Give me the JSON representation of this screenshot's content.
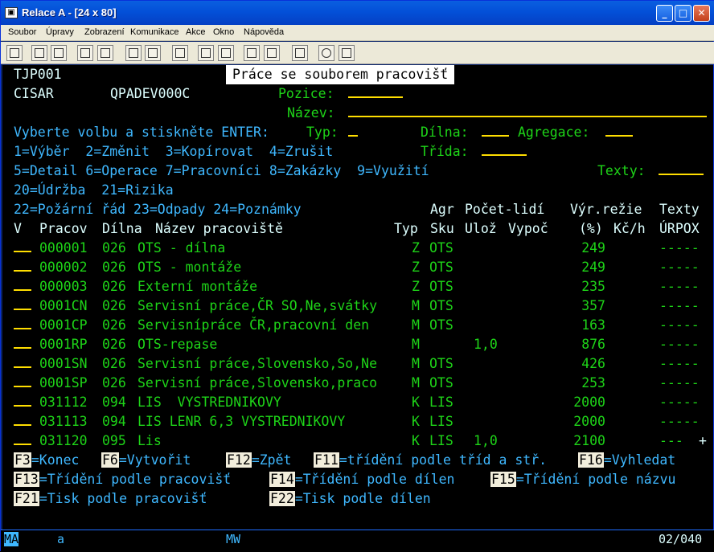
{
  "window": {
    "title": "Relace A - [24 x 80]",
    "icon": "terminal-icon",
    "min": "_",
    "max": "□",
    "close": "✕"
  },
  "menu": [
    "Soubor",
    "Úpravy",
    "Zobrazení",
    "Komunikace",
    "Akce",
    "Okno",
    "Nápověda"
  ],
  "toolbar": [
    "print-screen-icon",
    "copy-icon",
    "paste-icon",
    "send-icon",
    "receive-icon",
    "display-icon",
    "keyboard-icon",
    "macro-icon",
    "record-icon",
    "play-icon",
    "stop-icon",
    "clipboard-icon",
    "globe-icon",
    "pencil-icon"
  ],
  "screen": {
    "sys_id": "TJP001",
    "user": "CISAR",
    "device": "QPADEV000C",
    "title": "Práce se souborem pracovišť",
    "pozice_label": "Pozice:",
    "nazev_label": "Název:",
    "instruction": "Vyberte volbu a stiskněte ENTER:",
    "typ_label": "Typ:",
    "dilna_label": "Dílna:",
    "agregace_label": "Agregace:",
    "trida_label": "Třída:",
    "texty_label": "Texty:",
    "opt1": "1=Výběr  2=Změnit  3=Kopírovat  4=Zrušit",
    "opt2": "5=Detail 6=Operace 7=Pracovníci 8=Zakázky  9=Využití",
    "opt3": "20=Údržba  21=Rizika",
    "opt4": "22=Požární řád 23=Odpady 24=Poznámky",
    "h1": {
      "agr": "Agr",
      "pocet": "Počet-lidí",
      "vyr": "Výr.režie",
      "texty": "Texty"
    },
    "h2": {
      "v": "V",
      "prac": "Pracov",
      "dilna": "Dílna",
      "nazev": "Název pracoviště",
      "typ": "Typ",
      "sku": "Sku",
      "uloz": "Ulož",
      "vypoc": "Vypoč",
      "pct": "(%)",
      "kch": "Kč/h",
      "urpox": "ÚRPOX"
    },
    "rows": [
      {
        "prac": "000001",
        "dilna": "026",
        "nazev": "OTS - dílna",
        "typ": "Z",
        "sku": "OTS",
        "uloz": "",
        "vyr": "249",
        "texty": "-----"
      },
      {
        "prac": "000002",
        "dilna": "026",
        "nazev": "OTS - montáže",
        "typ": "Z",
        "sku": "OTS",
        "uloz": "",
        "vyr": "249",
        "texty": "-----"
      },
      {
        "prac": "000003",
        "dilna": "026",
        "nazev": "Externí montáže",
        "typ": "Z",
        "sku": "OTS",
        "uloz": "",
        "vyr": "235",
        "texty": "-----"
      },
      {
        "prac": "0001CN",
        "dilna": "026",
        "nazev": "Servisní práce,ČR SO,Ne,svátky",
        "typ": "M",
        "sku": "OTS",
        "uloz": "",
        "vyr": "357",
        "texty": "-----"
      },
      {
        "prac": "0001CP",
        "dilna": "026",
        "nazev": "Servisnípráce ČR,pracovní den",
        "typ": "M",
        "sku": "OTS",
        "uloz": "",
        "vyr": "163",
        "texty": "-----"
      },
      {
        "prac": "0001RP",
        "dilna": "026",
        "nazev": "OTS-repase",
        "typ": "M",
        "sku": "",
        "uloz": "1,0",
        "vyr": "876",
        "texty": "-----"
      },
      {
        "prac": "0001SN",
        "dilna": "026",
        "nazev": "Servisní práce,Slovensko,So,Ne",
        "typ": "M",
        "sku": "OTS",
        "uloz": "",
        "vyr": "426",
        "texty": "-----"
      },
      {
        "prac": "0001SP",
        "dilna": "026",
        "nazev": "Servisní práce,Slovensko,praco",
        "typ": "M",
        "sku": "OTS",
        "uloz": "",
        "vyr": "253",
        "texty": "-----"
      },
      {
        "prac": "031112",
        "dilna": "094",
        "nazev": "LIS  VYSTREDNIKOVY",
        "typ": "K",
        "sku": "LIS",
        "uloz": "",
        "vyr": "2000",
        "texty": "-----"
      },
      {
        "prac": "031113",
        "dilna": "094",
        "nazev": "LIS LENR 6,3 VYSTREDNIKOVY",
        "typ": "K",
        "sku": "LIS",
        "uloz": "",
        "vyr": "2000",
        "texty": "-----"
      },
      {
        "prac": "031120",
        "dilna": "095",
        "nazev": "Lis",
        "typ": "K",
        "sku": "LIS",
        "uloz": "1,0",
        "vyr": "2100",
        "texty": "---"
      }
    ],
    "more": "+",
    "fkeys": [
      [
        {
          "k": "F3",
          "t": "=Konec"
        },
        {
          "k": "F6",
          "t": "=Vytvořit"
        },
        {
          "k": "F12",
          "t": "=Zpět"
        },
        {
          "k": "F11",
          "t": "=třídění podle tříd a stř."
        },
        {
          "k": "F16",
          "t": "=Vyhledat"
        }
      ],
      [
        {
          "k": "F13",
          "t": "=Třídění podle pracovišť"
        },
        {
          "k": "F14",
          "t": "=Třídění podle dílen"
        },
        {
          "k": "F15",
          "t": "=Třídění podle názvu"
        }
      ],
      [
        {
          "k": "F21",
          "t": "=Tisk podle pracovišť"
        },
        {
          "k": "F22",
          "t": "=Tisk podle dílen"
        }
      ]
    ]
  },
  "status": {
    "mode": "MA",
    "shift": "a",
    "mw": "MW",
    "pos": "02/040"
  }
}
